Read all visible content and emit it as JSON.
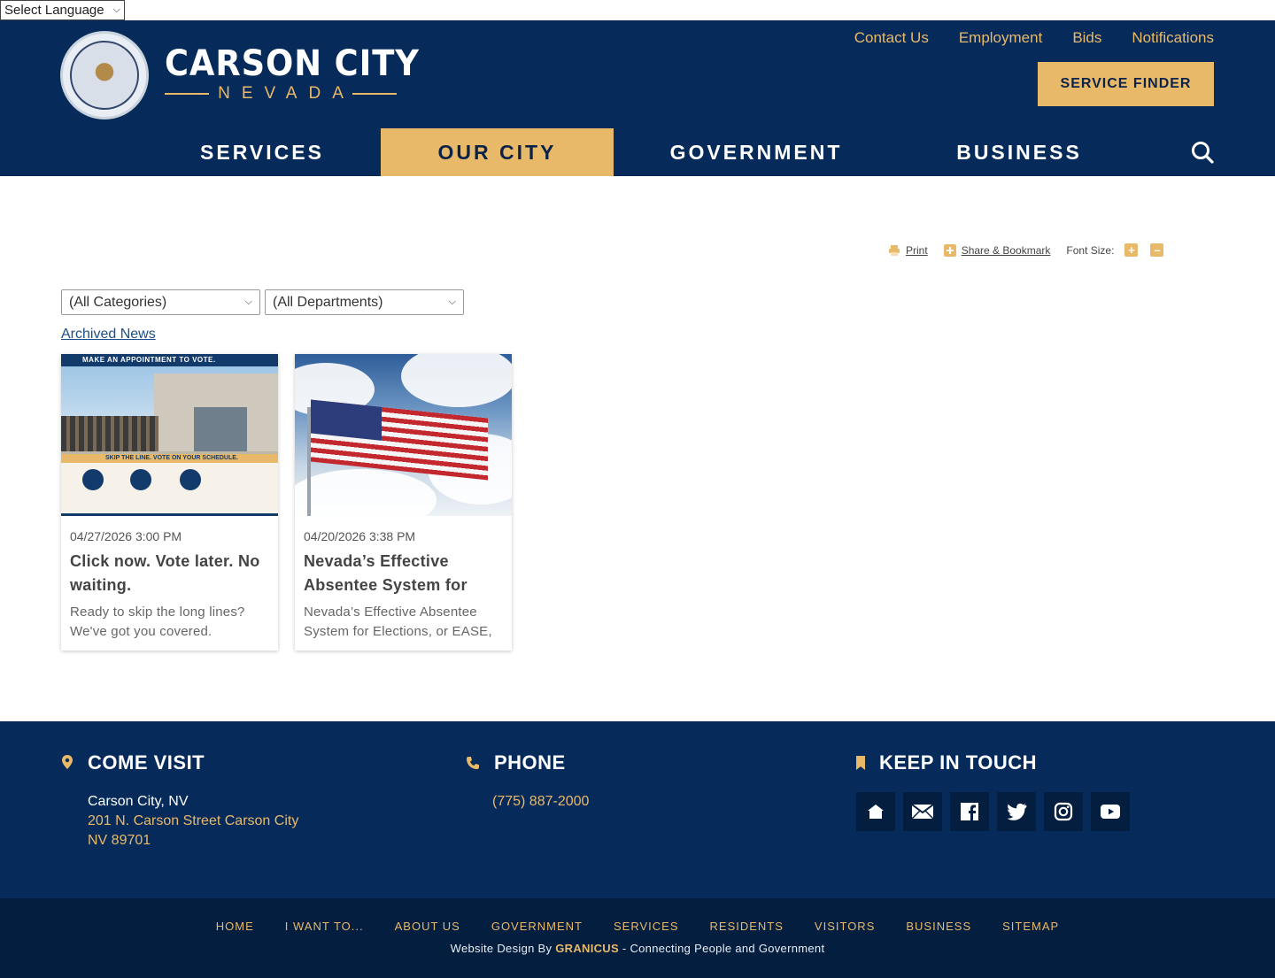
{
  "language": {
    "label": "Select Language"
  },
  "brand": {
    "name": "CARSON CITY",
    "state": "NEVADA"
  },
  "utility_nav": [
    "Contact Us",
    "Employment",
    "Bids",
    "Notifications"
  ],
  "service_finder": "SERVICE FINDER",
  "main_nav": [
    "SERVICES",
    "OUR CITY",
    "GOVERNMENT",
    "BUSINESS"
  ],
  "active_nav": "OUR CITY",
  "tools": {
    "print": "Print",
    "share": "Share & Bookmark",
    "font_size": "Font Size:"
  },
  "filters": {
    "category": "(All Categories)",
    "department": "(All Departments)"
  },
  "archived": "Archived News",
  "cards": [
    {
      "date": "04/27/2026 3:00 PM",
      "title": "Click now. Vote later. No waiting.",
      "desc": "Ready to skip the long lines? We've got you covered.",
      "image_caption_top": "MAKE AN APPOINTMENT TO VOTE.",
      "image_caption_band": "SKIP THE LINE. VOTE ON YOUR SCHEDULE."
    },
    {
      "date": "04/20/2026 3:38 PM",
      "title": "Nevada’s Effective Absentee System for",
      "desc": "Nevada’s Effective Absentee System for Elections, or EASE,"
    }
  ],
  "footer": {
    "visit": {
      "heading": "COME VISIT",
      "city": "Carson City, NV",
      "street": "201 N. Carson Street Carson City",
      "zip": "NV 89701"
    },
    "phone": {
      "heading": "PHONE",
      "number": "(775) 887-2000"
    },
    "touch": {
      "heading": "KEEP IN TOUCH"
    },
    "social_icons": [
      "home-icon",
      "mail-icon",
      "facebook-icon",
      "twitter-icon",
      "instagram-icon",
      "youtube-icon"
    ]
  },
  "bottom_links": [
    "HOME",
    "I WANT TO...",
    "ABOUT US",
    "GOVERNMENT",
    "SERVICES",
    "RESIDENTS",
    "VISITORS",
    "BUSINESS",
    "SITEMAP"
  ],
  "credit": {
    "prefix": "Website Design By",
    "brand": "GRANICUS",
    "suffix": "- Connecting People and Government"
  },
  "colors": {
    "navy": "#062b5a",
    "gold": "#e9b96a",
    "dark_navy": "#041e40"
  }
}
